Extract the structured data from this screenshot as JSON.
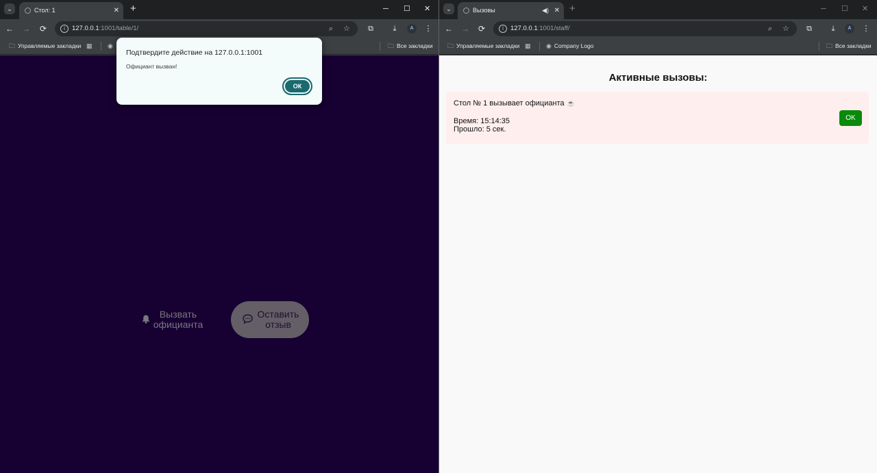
{
  "left_window": {
    "tab_title": "Стол: 1",
    "tab_close": "✕",
    "new_tab": "+",
    "url_host": "127.0.0.1",
    "url_path": ":1001/table/1/",
    "bookmarks": {
      "managed": "Управляемые закладки",
      "all": "Все закладки"
    },
    "page": {
      "bg_color": "#170032",
      "call_waiter_label": "Вызвать официанта",
      "leave_review_label": "Оставить отзыв"
    },
    "dialog": {
      "title": "Подтвердите действие на 127.0.0.1:1001",
      "message": "Официант вызван!",
      "ok_label": "ОК"
    }
  },
  "right_window": {
    "tab_title": "Вызовы",
    "tab_close": "✕",
    "new_tab": "+",
    "url_host": "127.0.0.1",
    "url_path": ":1001/staff/",
    "bookmarks": {
      "managed": "Управляемые закладки",
      "company": "Company Logo",
      "all": "Все закладки"
    },
    "page": {
      "heading": "Активные вызовы:",
      "calls": [
        {
          "text": "Стол № 1 вызывает официанта",
          "icon": "☕",
          "time": "Время: 15:14:35",
          "elapsed": "Прошло: 5 сек.",
          "ok_label": "OK"
        }
      ]
    }
  },
  "colors": {
    "accent_teal": "#1a6a6f",
    "ok_green": "#0a8a0a",
    "call_card_bg": "#ffeeee"
  }
}
